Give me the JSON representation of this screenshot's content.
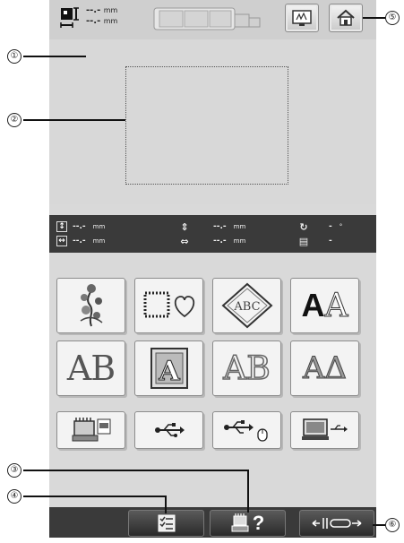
{
  "header": {
    "size_width_value": "--.-",
    "size_height_value": "--.-",
    "size_unit": "mm"
  },
  "info": {
    "height_value": "--.-",
    "width_value": "--.-",
    "offset_v_value": "--.-",
    "offset_h_value": "--.-",
    "unit": "mm",
    "angle_value": "-",
    "angle_unit": "°",
    "color_count": "-"
  },
  "categories": [
    {
      "name": "floral-pattern",
      "label": ""
    },
    {
      "name": "frame-shapes",
      "label": ""
    },
    {
      "name": "monogram",
      "label": "ABC"
    },
    {
      "name": "alphabet-fonts",
      "label": "AA"
    },
    {
      "name": "decorative-alphabet",
      "label": "AB"
    },
    {
      "name": "floral-alphabet",
      "label": "A"
    },
    {
      "name": "outline-alphabet",
      "label": "AB"
    },
    {
      "name": "greek-alphabet",
      "label": "AΔ"
    }
  ],
  "bottom": {
    "help_label": "?"
  },
  "callouts": {
    "c1": "①",
    "c2": "②",
    "c3": "③",
    "c4": "④",
    "c5": "⑤",
    "c6": "⑥"
  }
}
